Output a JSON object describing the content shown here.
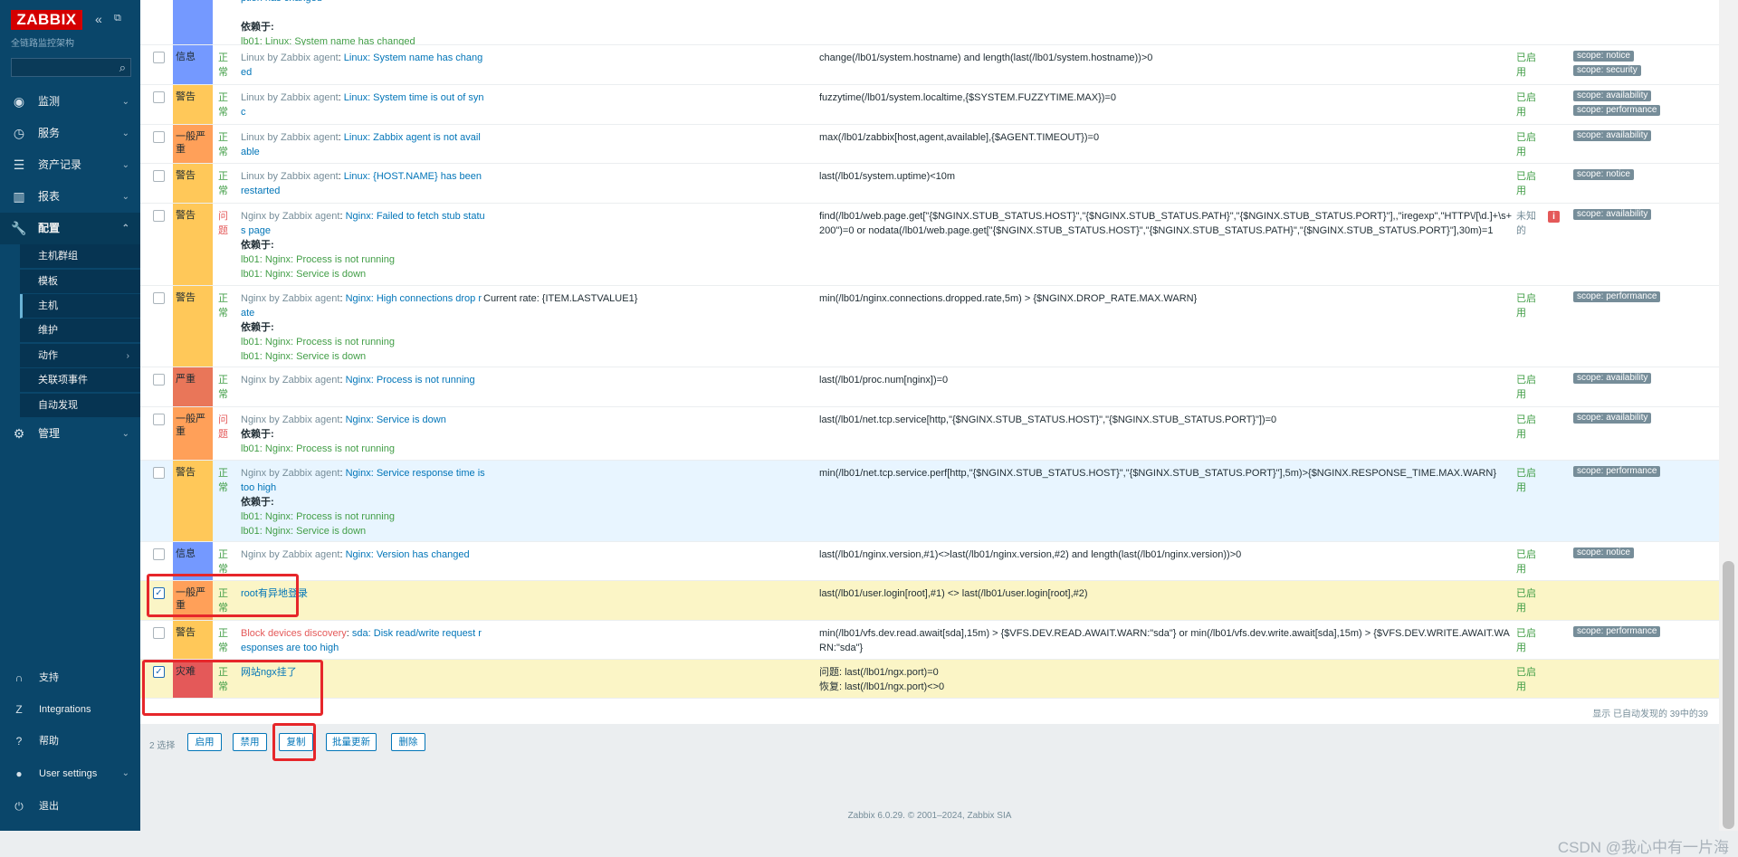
{
  "sidebar": {
    "logo": "ZABBIX",
    "subtitle": "全链路监控架构",
    "collapse_icon": "«",
    "popout_icon": "⧉",
    "search_placeholder": "",
    "nav": [
      {
        "label": "监测",
        "icon": "eye-icon"
      },
      {
        "label": "服务",
        "icon": "clock-icon"
      },
      {
        "label": "资产记录",
        "icon": "list-icon"
      },
      {
        "label": "报表",
        "icon": "bar-chart-icon"
      },
      {
        "label": "配置",
        "icon": "wrench-icon"
      },
      {
        "label": "管理",
        "icon": "gear-icon"
      }
    ],
    "config_sub": [
      "主机群组",
      "模板",
      "主机",
      "维护",
      "动作",
      "关联项事件",
      "自动发现"
    ],
    "bottom": [
      {
        "label": "支持",
        "icon": "headset-icon"
      },
      {
        "label": "Integrations",
        "icon": "z-icon"
      },
      {
        "label": "帮助",
        "icon": "question-icon"
      },
      {
        "label": "User settings",
        "icon": "user-icon"
      },
      {
        "label": "退出",
        "icon": "power-icon"
      }
    ]
  },
  "severity_colors": {
    "信息": "#7499ff",
    "警告": "#ffc859",
    "一般严重": "#ffa059",
    "严重": "#e97659",
    "灾难": "#e45959"
  },
  "rows": [
    {
      "sev": "",
      "st": "常",
      "name_lines": [
        "ption has changed"
      ],
      "dep_label": "依赖于:",
      "deps": [
        "lb01: Linux: System name has changed"
      ],
      "expr": "",
      "en": "用",
      "tags": []
    },
    {
      "sev": "信息",
      "st": "正常",
      "tpl": "Linux by Zabbix agent",
      "name": "Linux: System name has changed",
      "expr": "change(/lb01/system.hostname) and length(last(/lb01/system.hostname))>0",
      "en": "已启用",
      "tags": [
        "scope: notice",
        "scope: security"
      ]
    },
    {
      "sev": "警告",
      "st": "正常",
      "tpl": "Linux by Zabbix agent",
      "name": "Linux: System time is out of sync",
      "expr": "fuzzytime(/lb01/system.localtime,{$SYSTEM.FUZZYTIME.MAX})=0",
      "en": "已启用",
      "tags": [
        "scope: availability",
        "scope: performance"
      ]
    },
    {
      "sev": "一般严重",
      "st": "正常",
      "tpl": "Linux by Zabbix agent",
      "name": "Linux: Zabbix agent is not available",
      "expr": "max(/lb01/zabbix[host,agent,available],{$AGENT.TIMEOUT})=0",
      "en": "已启用",
      "tags": [
        "scope: availability"
      ]
    },
    {
      "sev": "警告",
      "st": "正常",
      "tpl": "Linux by Zabbix agent",
      "name": "Linux: {HOST.NAME} has been restarted",
      "expr": "last(/lb01/system.uptime)<10m",
      "en": "已启用",
      "tags": [
        "scope: notice"
      ]
    },
    {
      "sev": "警告",
      "st": "问题",
      "tpl": "Nginx by Zabbix agent",
      "name": "Nginx: Failed to fetch stub status page",
      "dep_label": "依赖于:",
      "deps": [
        "lb01: Nginx: Process is not running",
        "lb01: Nginx: Service is down"
      ],
      "expr": "find(/lb01/web.page.get[\"{$NGINX.STUB_STATUS.HOST}\",\"{$NGINX.STUB_STATUS.PATH}\",\"{$NGINX.STUB_STATUS.PORT}\"],,\"iregexp\",\"HTTP\\/[\\d.]+\\s+200\")=0 or nodata(/lb01/web.page.get[\"{$NGINX.STUB_STATUS.HOST}\",\"{$NGINX.STUB_STATUS.PATH}\",\"{$NGINX.STUB_STATUS.PORT}\"],30m)=1",
      "en": "未知的",
      "info": "i",
      "tags": [
        "scope: availability"
      ]
    },
    {
      "sev": "警告",
      "st": "正常",
      "tpl": "Nginx by Zabbix agent",
      "name": "Nginx: High connections drop rate",
      "comment": "Current rate: {ITEM.LASTVALUE1}",
      "dep_label": "依赖于:",
      "deps": [
        "lb01: Nginx: Process is not running",
        "lb01: Nginx: Service is down"
      ],
      "expr": "min(/lb01/nginx.connections.dropped.rate,5m) > {$NGINX.DROP_RATE.MAX.WARN}",
      "en": "已启用",
      "tags": [
        "scope: performance"
      ]
    },
    {
      "sev": "严重",
      "st": "正常",
      "tpl": "Nginx by Zabbix agent",
      "name": "Nginx: Process is not running",
      "expr": "last(/lb01/proc.num[nginx])=0",
      "en": "已启用",
      "tags": [
        "scope: availability"
      ]
    },
    {
      "sev": "一般严重",
      "st": "问题",
      "tpl": "Nginx by Zabbix agent",
      "name": "Nginx: Service is down",
      "dep_label": "依赖于:",
      "deps": [
        "lb01: Nginx: Process is not running"
      ],
      "expr": "last(/lb01/net.tcp.service[http,\"{$NGINX.STUB_STATUS.HOST}\",\"{$NGINX.STUB_STATUS.PORT}\"])=0",
      "en": "已启用",
      "tags": [
        "scope: availability"
      ]
    },
    {
      "sev": "警告",
      "st": "正常",
      "tpl": "Nginx by Zabbix agent",
      "name": "Nginx: Service response time is too high",
      "dep_label": "依赖于:",
      "deps": [
        "lb01: Nginx: Process is not running",
        "lb01: Nginx: Service is down"
      ],
      "expr": "min(/lb01/net.tcp.service.perf[http,\"{$NGINX.STUB_STATUS.HOST}\",\"{$NGINX.STUB_STATUS.PORT}\"],5m)>{$NGINX.RESPONSE_TIME.MAX.WARN}",
      "en": "已启用",
      "tags": [
        "scope: performance"
      ]
    },
    {
      "sev": "信息",
      "st": "正常",
      "tpl": "Nginx by Zabbix agent",
      "name": "Nginx: Version has changed",
      "expr": "last(/lb01/nginx.version,#1)<>last(/lb01/nginx.version,#2) and length(last(/lb01/nginx.version))>0",
      "en": "已启用",
      "tags": [
        "scope: notice"
      ]
    },
    {
      "sev": "一般严重",
      "st": "正常",
      "name": "root有异地登录",
      "checked": true,
      "expr": "last(/lb01/user.login[root],#1) <> last(/lb01/user.login[root],#2)",
      "en": "已启用",
      "tags": []
    },
    {
      "sev": "警告",
      "st": "正常",
      "tpl": "Block devices discovery",
      "tpl_red": true,
      "name": "sda: Disk read/write request responses are too high",
      "expr": "min(/lb01/vfs.dev.read.await[sda],15m) > {$VFS.DEV.READ.AWAIT.WARN:\"sda\"} or min(/lb01/vfs.dev.write.await[sda],15m) > {$VFS.DEV.WRITE.AWAIT.WARN:\"sda\"}",
      "en": "已启用",
      "tags": [
        "scope: performance"
      ]
    },
    {
      "sev": "灾难",
      "st": "正常",
      "name": "网站ngx挂了",
      "checked": true,
      "expr_lines": [
        "问题: last(/lb01/ngx.port)=0",
        "恢复: last(/lb01/ngx.port)<>0"
      ],
      "en": "已启用",
      "tags": []
    }
  ],
  "summary": "显示 已自动发现的 39中的39",
  "actions": {
    "selected": "2 选择",
    "buttons": [
      "启用",
      "禁用",
      "复制",
      "批量更新",
      "删除"
    ]
  },
  "footer": "Zabbix 6.0.29. © 2001–2024, Zabbix SIA",
  "watermark": "CSDN @我心中有一片海"
}
